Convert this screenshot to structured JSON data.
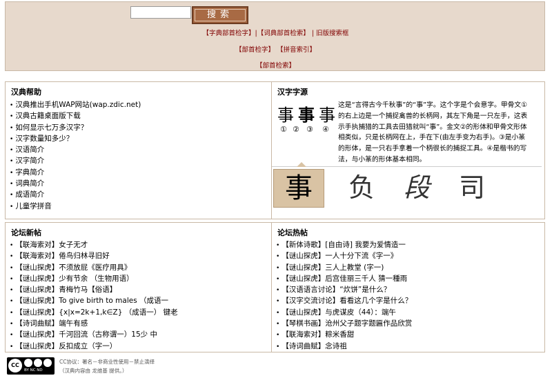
{
  "search": {
    "value": "",
    "button_label": "搜索"
  },
  "top_links": {
    "row1": [
      "【字典部首检字】",
      "【词典部首检索】",
      "旧版搜索框"
    ],
    "row2": [
      "【部首检字】",
      "【拼音索引】"
    ],
    "row3": [
      "【部首检索】"
    ],
    "seps": [
      "|",
      "|"
    ]
  },
  "help": {
    "title": "汉典帮助",
    "items": [
      "汉典推出手机WAP网站(wap.zdic.net)",
      "汉典古籍桌面版下载",
      "如何显示七万多汉字？",
      "汉字数量知多少？",
      "汉语简介",
      "汉字简介",
      "字典简介",
      "词典简介",
      "成语简介",
      "儿童学拼音"
    ]
  },
  "origin": {
    "title": "汉字字源",
    "char": "事",
    "circled": [
      "①",
      "②",
      "③",
      "④"
    ],
    "description": "这是“言得古今千秋事”的“事”字。这个字是个会意字。甲骨文①的右上边是一个捕捉禽兽的长柄网，其左下角是一只左手，这表示手执捕猎的工具去田猎就叫“事”。金文②的形体和甲骨文形体相类似，只是长柄网在上，手在下(由左手变为右手)。③是小篆的形体，是一只右手拿着一个柄很长的捕捉工具。④是楷书的写法，与小篆的形体基本相同。",
    "strip_chars": [
      "事",
      "负",
      "段",
      "司"
    ]
  },
  "forum_new": {
    "title": "论坛新帖",
    "items": [
      "【联海索对】女子无才",
      "【联海索对】倦鸟归林寻旧好",
      "【谜山探虎】不须放屁《医疗用具》",
      "【谜山探虎】少有节余 （生物用语）",
      "【谜山探虎】青梅竹马【俗语】",
      "【谜山探虎】To give birth to males （成语一",
      "【谜山探虎】{x|x=2k+1,k∈Z} （成语一） 键老",
      "【诗词曲赋】端午有感",
      "【谜山探虎】千河回流（古称谓一）15少 中",
      "【谜山探虎】反扣成立（字一）"
    ]
  },
  "forum_hot": {
    "title": "论坛热帖",
    "items": [
      "【新体诗歌】[自由诗] 我要为爱情造一",
      "【谜山探虎】一人十分下流《字一》",
      "【谜山探虎】三人上教堂 (字一)",
      "【谜山探虎】后宫佳丽三千人 猜一種雨",
      "【汉语语言讨论】“炊饼”是什么？",
      "【汉字交流讨论】看看这几个字是什么？",
      "【谜山探虎】与虎谋皮（44）：端午",
      "【琴棋书画】沧州父子题字题匾作品欣赏",
      "【联海索对】粽米香甜",
      "【诗词曲赋】念诗祖"
    ]
  },
  "footer": {
    "cc_label": "CC",
    "cc_sub": "BY  NC  ND",
    "line1": "CC协议：署名－非商业性使用－禁止演绎",
    "line2": "（汉典内容由 龙维基 提供。）"
  },
  "colors": {
    "top_bg": "#e7d9cc",
    "link_red": "#800000",
    "button": "#a86a44",
    "strip_selected": "#d9c3a4"
  }
}
